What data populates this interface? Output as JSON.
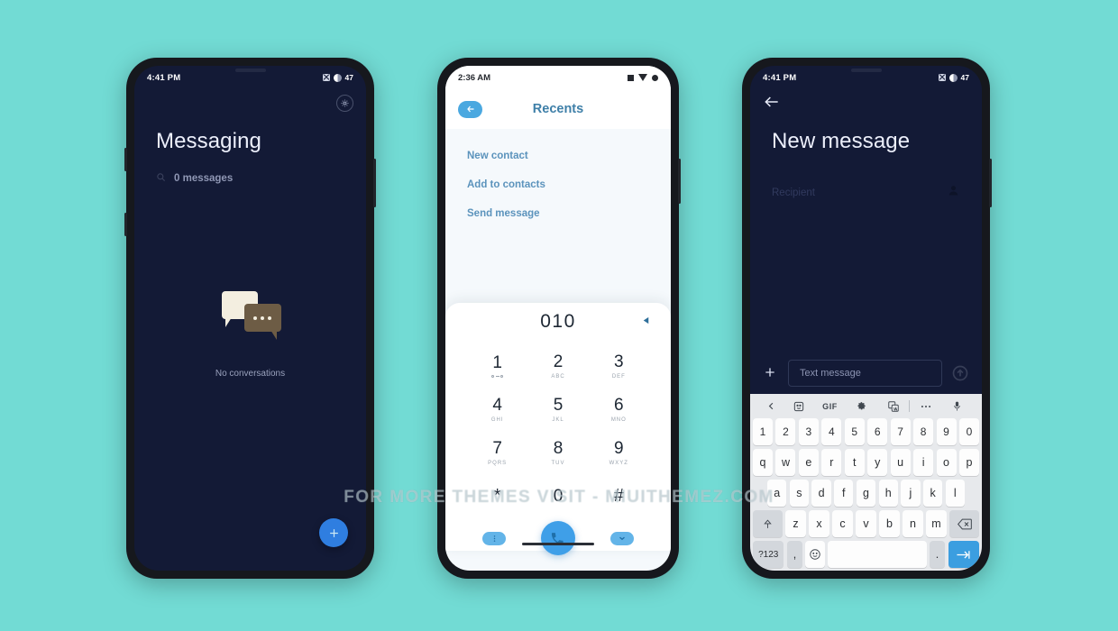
{
  "wallpaper": {
    "color": "#72dbd4"
  },
  "watermark": {
    "text": "FOR MORE THEMES VISIT - MIUITHEMEZ.COM"
  },
  "theme": {
    "dark_bg": "#131a36",
    "light_bg": "#f5f9fc",
    "accent_blue": "#3f9fe8",
    "link_blue": "#5b93bc",
    "fab_blue": "#2f7ee0"
  },
  "phone1": {
    "status": {
      "time": "4:41 PM",
      "battery": "47",
      "sim_icon": "sim-off-icon",
      "battery_icon": "battery-half-icon"
    },
    "topbar": {
      "settings_icon": "gear-icon"
    },
    "title": "Messaging",
    "search": {
      "icon": "search-icon",
      "placeholder": "0 messages",
      "value": "0 messages"
    },
    "empty_state": {
      "icon": "chat-bubbles-icon",
      "text": "No conversations"
    },
    "fab": {
      "icon": "plus-icon",
      "label": "+"
    }
  },
  "phone2": {
    "status": {
      "time": "2:36 AM",
      "icons": [
        "square-icon",
        "triangle-down-icon",
        "circle-icon"
      ]
    },
    "appbar": {
      "back_icon": "arrow-left-icon",
      "title": "Recents"
    },
    "menu": [
      {
        "label": "New contact"
      },
      {
        "label": "Add to contacts"
      },
      {
        "label": "Send message"
      }
    ],
    "dialer": {
      "number": "010",
      "backspace_icon": "backspace-triangle-icon",
      "keys": [
        {
          "digit": "1",
          "sub": "",
          "sub_icon": "voicemail-icon"
        },
        {
          "digit": "2",
          "sub": "ABC"
        },
        {
          "digit": "3",
          "sub": "DEF"
        },
        {
          "digit": "4",
          "sub": "GHI"
        },
        {
          "digit": "5",
          "sub": "JKL"
        },
        {
          "digit": "6",
          "sub": "MNO"
        },
        {
          "digit": "7",
          "sub": "PQRS"
        },
        {
          "digit": "8",
          "sub": "TUV"
        },
        {
          "digit": "9",
          "sub": "WXYZ"
        },
        {
          "digit": "*",
          "sub": ""
        },
        {
          "digit": "0",
          "sub": "+"
        },
        {
          "digit": "#",
          "sub": ""
        }
      ],
      "actions": {
        "left_icon": "more-options-icon",
        "call_icon": "phone-call-icon",
        "right_icon": "chevron-down-icon"
      }
    },
    "nav": {
      "pill": "home-gesture-pill"
    }
  },
  "phone3": {
    "status": {
      "time": "4:41 PM",
      "battery": "47",
      "sim_icon": "sim-off-icon",
      "battery_icon": "battery-half-icon"
    },
    "topbar": {
      "back_icon": "arrow-left-icon"
    },
    "title": "New message",
    "recipient": {
      "placeholder": "Recipient",
      "contact_icon": "person-icon"
    },
    "compose": {
      "attach_icon": "plus-icon",
      "input_placeholder": "Text message",
      "send_icon": "send-icon"
    },
    "keyboard": {
      "toolbar": [
        {
          "name": "collapse-toolbar",
          "icon": "chevron-left-icon",
          "label": ""
        },
        {
          "name": "sticker",
          "icon": "sticker-icon",
          "label": ""
        },
        {
          "name": "gif",
          "icon": "gif-icon",
          "label": "GIF"
        },
        {
          "name": "settings",
          "icon": "gear-icon",
          "label": ""
        },
        {
          "name": "translate",
          "icon": "translate-icon",
          "label": ""
        },
        {
          "name": "more",
          "icon": "more-horizontal-icon",
          "label": ""
        },
        {
          "name": "voice-input",
          "icon": "microphone-icon",
          "label": ""
        }
      ],
      "row_numbers": [
        "1",
        "2",
        "3",
        "4",
        "5",
        "6",
        "7",
        "8",
        "9",
        "0"
      ],
      "row_qwerty": [
        "q",
        "w",
        "e",
        "r",
        "t",
        "y",
        "u",
        "i",
        "o",
        "p"
      ],
      "row_asdf": [
        "a",
        "s",
        "d",
        "f",
        "g",
        "h",
        "j",
        "k",
        "l"
      ],
      "row_zxcv": [
        "z",
        "x",
        "c",
        "v",
        "b",
        "n",
        "m"
      ],
      "shift_icon": "shift-arrow-up-icon",
      "backspace_icon": "backspace-icon",
      "bottom": {
        "symbols_label": "?123",
        "comma_label": ",",
        "emoji_icon": "emoji-smiley-icon",
        "space_label": "",
        "period_label": ".",
        "enter_icon": "enter-arrow-icon"
      }
    }
  }
}
